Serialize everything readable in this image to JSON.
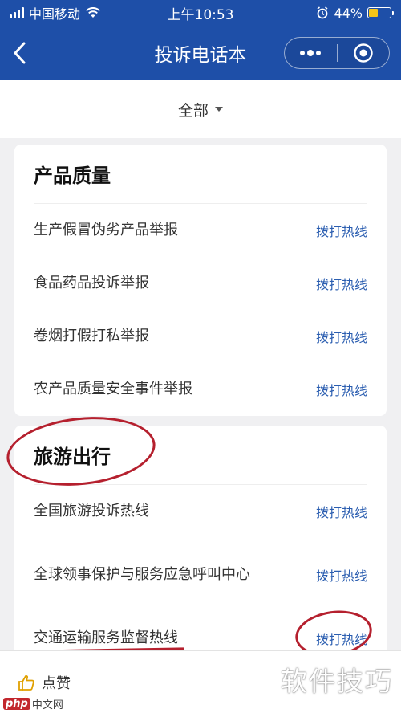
{
  "status_bar": {
    "carrier": "中国移动",
    "time": "上午10:53",
    "battery": "44%",
    "battery_level": 0.44
  },
  "nav": {
    "title": "投诉电话本",
    "back_icon": "chevron-left-icon",
    "more_icon": "more-dots-icon",
    "close_icon": "target-circle-icon"
  },
  "filter": {
    "label": "全部"
  },
  "sections": [
    {
      "title": "产品质量",
      "items": [
        {
          "label": "生产假冒伪劣产品举报",
          "action": "拨打热线"
        },
        {
          "label": "食品药品投诉举报",
          "action": "拨打热线"
        },
        {
          "label": "卷烟打假打私举报",
          "action": "拨打热线"
        },
        {
          "label": "农产品质量安全事件举报",
          "action": "拨打热线"
        }
      ]
    },
    {
      "title": "旅游出行",
      "items": [
        {
          "label": "全国旅游投诉热线",
          "action": "拨打热线"
        },
        {
          "label": "全球领事保护与服务应急呼叫中心",
          "action": "拨打热线"
        },
        {
          "label": "交通运输服务监督热线",
          "action": "拨打热线"
        }
      ]
    }
  ],
  "bottom": {
    "like_label": "点赞",
    "watermark": "软件技巧",
    "logo_text": "中文网",
    "logo_badge": "php"
  },
  "colors": {
    "nav_bg": "#1e4fa8",
    "action": "#2a5db0",
    "annotation": "#b5202e"
  }
}
